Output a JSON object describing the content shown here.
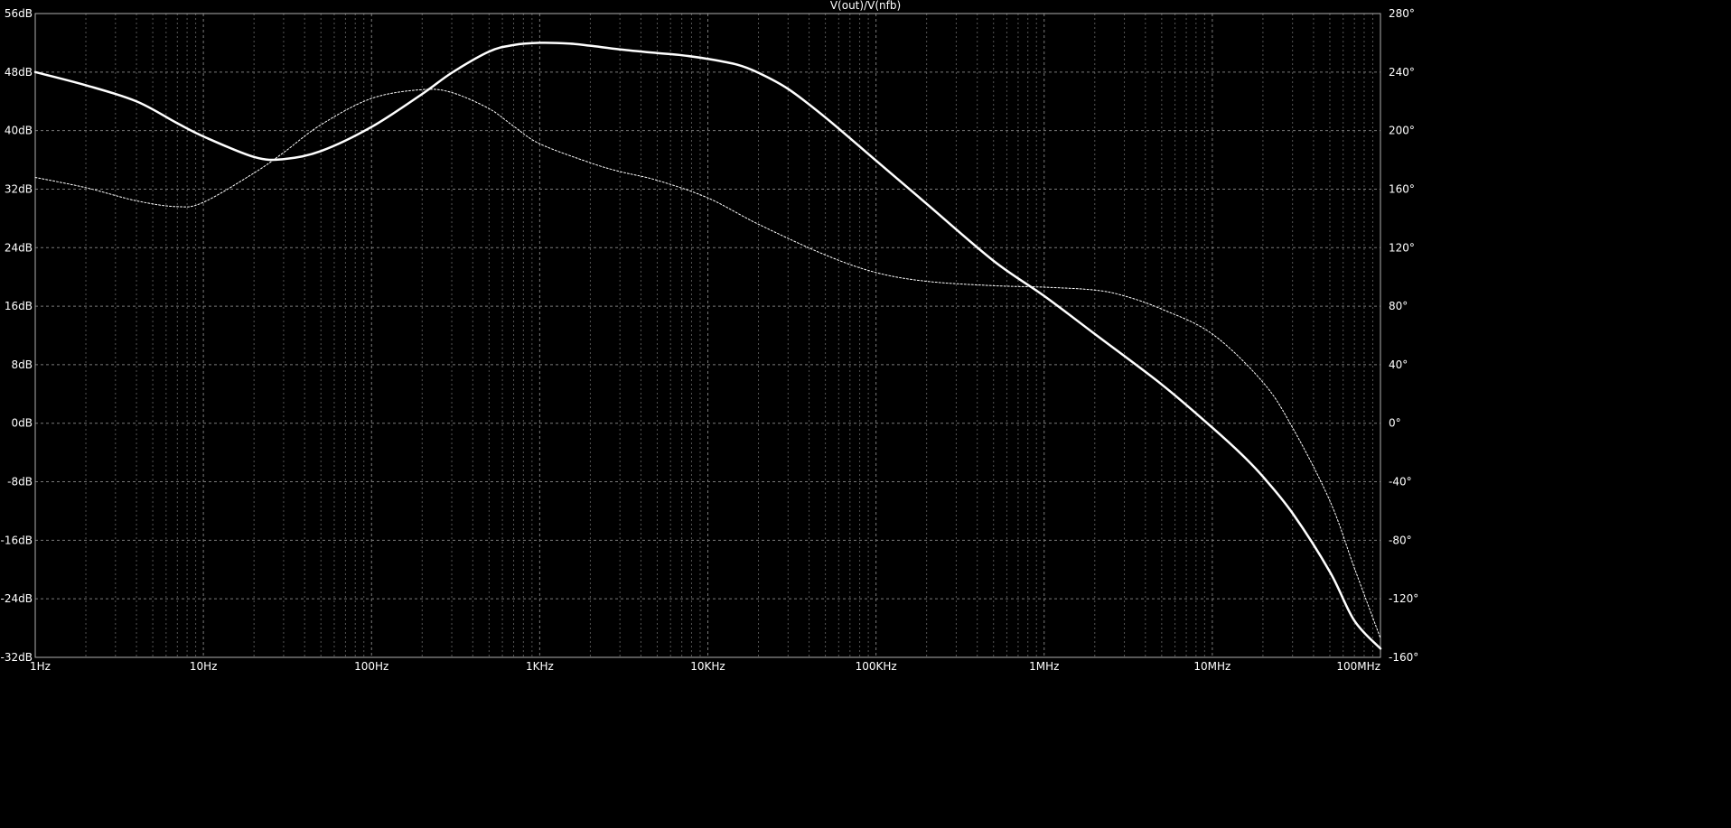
{
  "chart_data": {
    "type": "line",
    "title": "V(out)/V(nfb)",
    "x_scale": "log",
    "xlim": [
      1,
      100000000
    ],
    "x_ticks": [
      {
        "value": 1,
        "label": "1Hz"
      },
      {
        "value": 10,
        "label": "10Hz"
      },
      {
        "value": 100,
        "label": "100Hz"
      },
      {
        "value": 1000,
        "label": "1KHz"
      },
      {
        "value": 10000,
        "label": "10KHz"
      },
      {
        "value": 100000,
        "label": "100KHz"
      },
      {
        "value": 1000000,
        "label": "1MHz"
      },
      {
        "value": 10000000,
        "label": "10MHz"
      },
      {
        "value": 100000000,
        "label": "100MHz"
      }
    ],
    "ylim_left": [
      -32,
      56
    ],
    "y_ticks_left": [
      {
        "value": 56,
        "label": "56dB"
      },
      {
        "value": 48,
        "label": "48dB"
      },
      {
        "value": 40,
        "label": "40dB"
      },
      {
        "value": 32,
        "label": "32dB"
      },
      {
        "value": 24,
        "label": "24dB"
      },
      {
        "value": 16,
        "label": "16dB"
      },
      {
        "value": 8,
        "label": "8dB"
      },
      {
        "value": 0,
        "label": "0dB"
      },
      {
        "value": -8,
        "label": "-8dB"
      },
      {
        "value": -16,
        "label": "-16dB"
      },
      {
        "value": -24,
        "label": "-24dB"
      },
      {
        "value": -32,
        "label": "-32dB"
      }
    ],
    "ylim_right": [
      -160,
      280
    ],
    "y_ticks_right": [
      {
        "value": 280,
        "label": "280°"
      },
      {
        "value": 240,
        "label": "240°"
      },
      {
        "value": 200,
        "label": "200°"
      },
      {
        "value": 160,
        "label": "160°"
      },
      {
        "value": 120,
        "label": "120°"
      },
      {
        "value": 80,
        "label": "80°"
      },
      {
        "value": 40,
        "label": "40°"
      },
      {
        "value": 0,
        "label": "0°"
      },
      {
        "value": -40,
        "label": "-40°"
      },
      {
        "value": -80,
        "label": "-80°"
      },
      {
        "value": -120,
        "label": "-120°"
      },
      {
        "value": -160,
        "label": "-160°"
      }
    ],
    "grid": true,
    "series": [
      {
        "axis": "left",
        "style": "solid",
        "color": "#ffffff",
        "x": [
          1,
          2,
          4,
          7,
          10,
          20,
          30,
          50,
          100,
          200,
          300,
          500,
          700,
          1000,
          1500,
          2000,
          3000,
          5000,
          7000,
          10000,
          15000,
          20000,
          30000,
          50000,
          100000,
          200000,
          500000,
          1000000,
          2000000,
          5000000,
          10000000,
          15000000,
          20000000,
          30000000,
          50000000,
          70000000,
          100000000
        ],
        "y": [
          48,
          46.2,
          44,
          41,
          39.2,
          36.4,
          36.1,
          37.2,
          40.5,
          45,
          47.9,
          50.8,
          51.7,
          52,
          51.9,
          51.6,
          51.1,
          50.6,
          50.3,
          49.8,
          49,
          47.9,
          45.7,
          41.8,
          35.9,
          30,
          22.2,
          17.4,
          12.2,
          5.3,
          -0.6,
          -4.3,
          -7.3,
          -12.3,
          -20.3,
          -27,
          -30.8
        ]
      },
      {
        "axis": "right",
        "style": "dotted",
        "color": "#ffffff",
        "x": [
          1,
          2,
          4,
          7,
          10,
          20,
          30,
          50,
          100,
          200,
          300,
          500,
          700,
          1000,
          2000,
          3000,
          5000,
          10000,
          20000,
          50000,
          100000,
          200000,
          500000,
          1000000,
          2000000,
          3000000,
          5000000,
          10000000,
          20000000,
          30000000,
          50000000,
          70000000,
          100000000
        ],
        "y": [
          168,
          161,
          152,
          148,
          151,
          171,
          185,
          204,
          222,
          228,
          226,
          215,
          203,
          191,
          178,
          172,
          166,
          154,
          136,
          115,
          103,
          97,
          94,
          93,
          91,
          87,
          78,
          61,
          28,
          -3,
          -53,
          -99,
          -147
        ]
      }
    ]
  }
}
